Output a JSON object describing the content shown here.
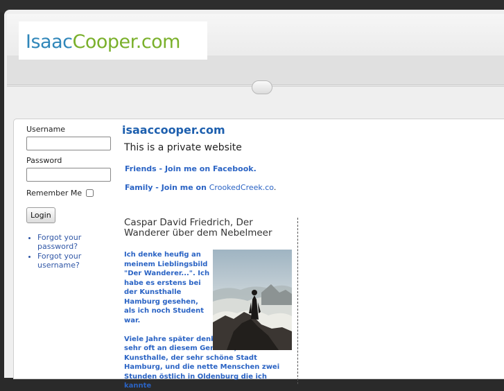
{
  "header": {
    "logo_part1": "Isaac",
    "logo_part2": "Cooper.com"
  },
  "login": {
    "username_label": "Username",
    "username_value": "",
    "password_label": "Password",
    "password_value": "",
    "remember_label": "Remember Me",
    "remember_checked": false,
    "submit_label": "Login",
    "links": [
      "Forgot your password?",
      "Forgot your username?"
    ]
  },
  "main": {
    "site_title": "isaaccooper.com",
    "private_text": "This is a private website",
    "friends_text": "Friends - Join me on Facebook.",
    "family_prefix": "Family - Join me on ",
    "family_link": "CrookedCreek.co",
    "family_suffix": "."
  },
  "article": {
    "title": "Caspar David Friedrich, Der Wanderer über dem Nebelmeer",
    "image_alt": "Wanderer above the Sea of Fog painting",
    "paragraph1": "Ich denke heufig an meinem Lieblingsbild \"Der Wanderer...\". Ich habe es erstens bei der Kunsthalle Hamburg gesehen, als ich noch Student war.",
    "paragraph2": "Viele Jahre später denke Ich immer noch sehr oft an diesem Gemälde, der Kunsthalle, der sehr schöne Stadt Hamburg, und die nette Menschen zwei Stunden östlich in Oldenburg die ich kannte"
  },
  "colors": {
    "logo_blue": "#2f86b9",
    "logo_green": "#7ab02b",
    "link_blue": "#2a63c4",
    "title_blue": "#1d5fae"
  }
}
